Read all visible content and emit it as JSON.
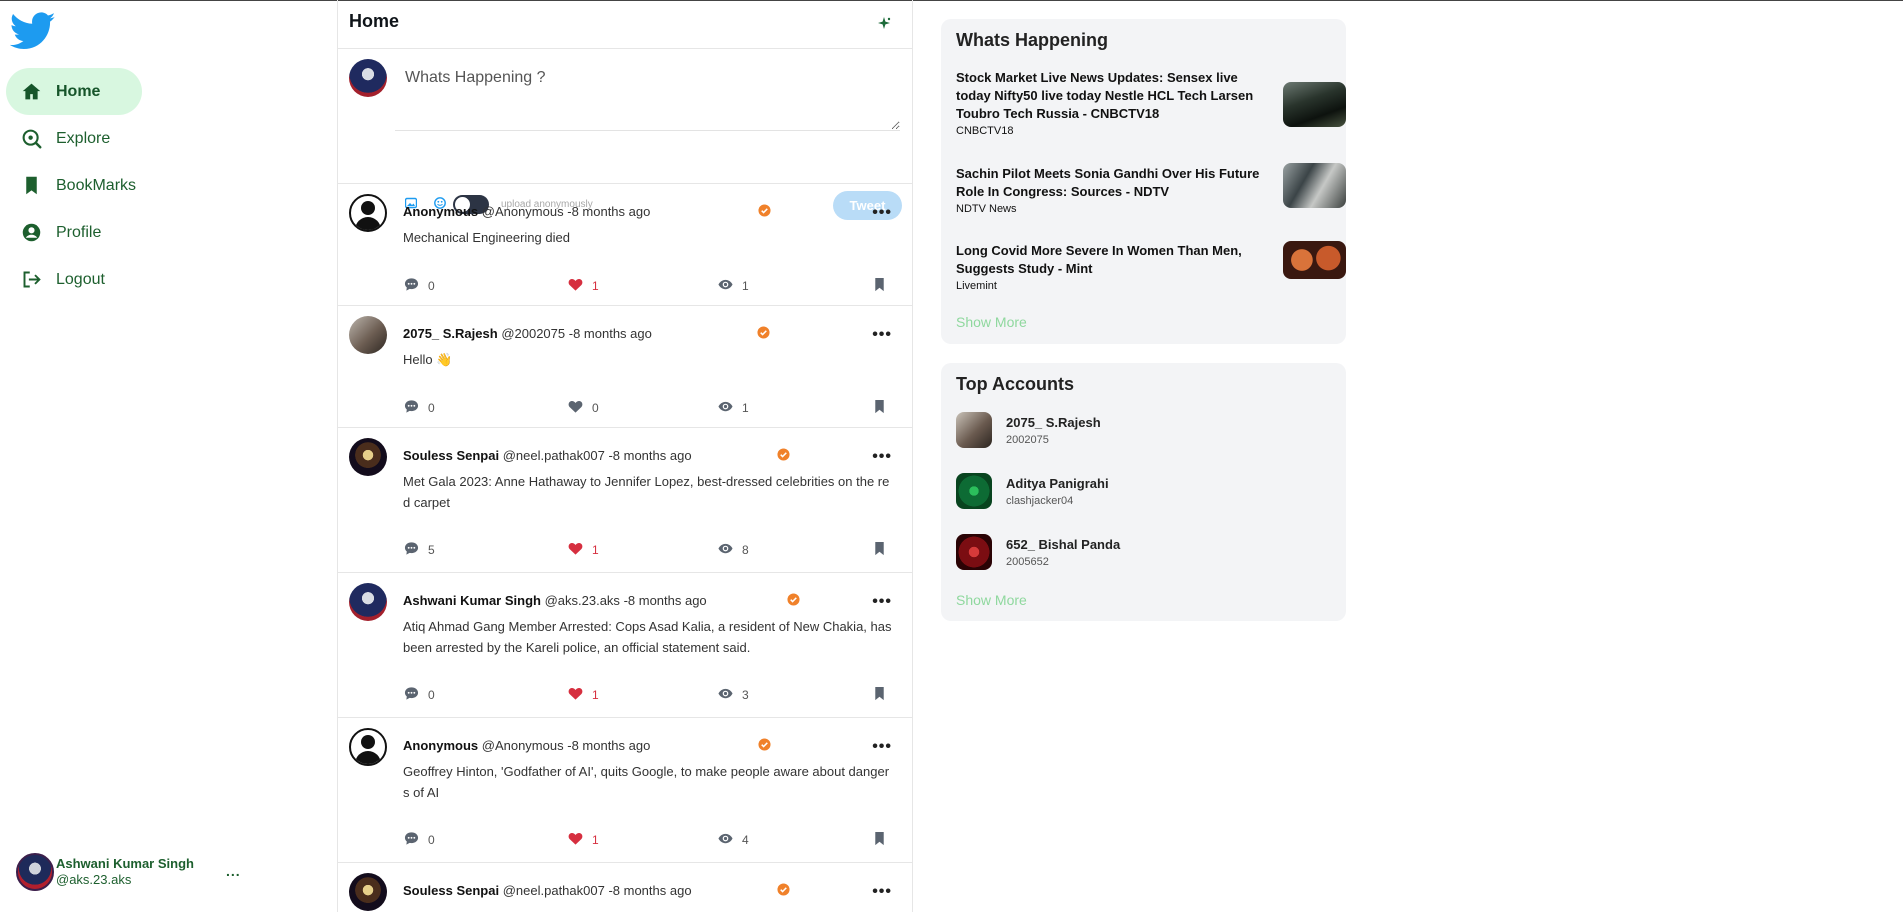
{
  "sidebar": {
    "nav": [
      {
        "label": "Home",
        "icon": "home-icon"
      },
      {
        "label": "Explore",
        "icon": "explore-icon"
      },
      {
        "label": "BookMarks",
        "icon": "bookmark-icon"
      },
      {
        "label": "Profile",
        "icon": "profile-icon"
      },
      {
        "label": "Logout",
        "icon": "logout-icon"
      }
    ],
    "user": {
      "name": "Ashwani Kumar Singh",
      "handle": "@aks.23.aks",
      "more": "..."
    }
  },
  "feed": {
    "title": "Home",
    "composer": {
      "placeholder": "Whats Happening ?",
      "anon_label": "upload anonymously",
      "tweet_button": "Tweet"
    },
    "posts": [
      {
        "name": "Anonymous",
        "handle": "@Anonymous",
        "time": "-8 months ago",
        "text": "Mechanical Engineering died",
        "comments": "0",
        "likes": "1",
        "views": "1",
        "liked": true
      },
      {
        "name": "2075_ S.Rajesh",
        "handle": "@2002075",
        "time": "-8 months ago",
        "text": "Hello 👋",
        "comments": "0",
        "likes": "0",
        "views": "1",
        "liked": false
      },
      {
        "name": "Souless Senpai",
        "handle": "@neel.pathak007",
        "time": "-8 months ago",
        "text": "Met Gala 2023: Anne Hathaway to Jennifer Lopez, best-dressed celebrities on the red carpet",
        "comments": "5",
        "likes": "1",
        "views": "8",
        "liked": true
      },
      {
        "name": "Ashwani Kumar Singh",
        "handle": "@aks.23.aks",
        "time": "-8 months ago",
        "text": "Atiq Ahmad Gang Member Arrested: Cops Asad Kalia, a resident of New Chakia, has been arrested by the Kareli police, an official statement said.",
        "comments": "0",
        "likes": "1",
        "views": "3",
        "liked": true
      },
      {
        "name": "Anonymous",
        "handle": "@Anonymous",
        "time": "-8 months ago",
        "text": "Geoffrey Hinton, 'Godfather of AI', quits Google, to make people aware about dangers of AI",
        "comments": "0",
        "likes": "1",
        "views": "4",
        "liked": true
      },
      {
        "name": "Souless Senpai",
        "handle": "@neel.pathak007",
        "time": "-8 months ago",
        "text": "",
        "comments": "",
        "likes": "",
        "views": "",
        "liked": false
      }
    ]
  },
  "happening": {
    "title": "Whats Happening",
    "items": [
      {
        "title": "Stock Market Live News Updates: Sensex live today Nifty50 live today Nestle HCL Tech Larsen Toubro Tech Russia - CNBCTV18",
        "source": "CNBCTV18"
      },
      {
        "title": "Sachin Pilot Meets Sonia Gandhi Over His Future Role In Congress: Sources - NDTV",
        "source": "NDTV News"
      },
      {
        "title": "Long Covid More Severe In Women Than Men, Suggests Study - Mint",
        "source": "Livemint"
      }
    ],
    "show_more": "Show More"
  },
  "top_accounts": {
    "title": "Top Accounts",
    "items": [
      {
        "name": "2075_ S.Rajesh",
        "handle": "2002075"
      },
      {
        "name": "Aditya Panigrahi",
        "handle": "clashjacker04"
      },
      {
        "name": "652_ Bishal Panda",
        "handle": "2005652"
      }
    ],
    "show_more": "Show More"
  },
  "colors": {
    "accent": "#1d5f2e",
    "active_bg": "#d8f7e0",
    "like": "#d62f3f",
    "verified": "#f0812a",
    "twitter_blue": "#1d9bf0"
  }
}
